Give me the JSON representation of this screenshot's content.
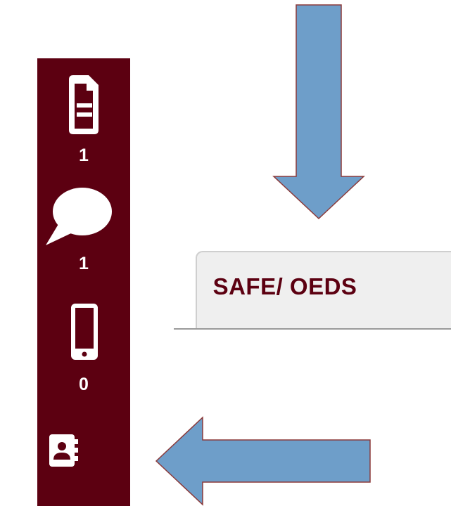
{
  "colors": {
    "sidebar_bg": "#5c0011",
    "tab_bg": "#efefef",
    "tab_text": "#5c0011",
    "arrow_fill": "#6e9ec9",
    "arrow_stroke": "#8b3a3a"
  },
  "sidebar": {
    "items": [
      {
        "icon": "document-icon",
        "count": "1"
      },
      {
        "icon": "chat-bubble-icon",
        "count": "1"
      },
      {
        "icon": "mobile-phone-icon",
        "count": "0"
      },
      {
        "icon": "contact-book-icon"
      }
    ]
  },
  "tab": {
    "label": "SAFE/ OEDS"
  },
  "annotations": [
    {
      "icon": "down-arrow-icon"
    },
    {
      "icon": "left-arrow-icon"
    }
  ]
}
